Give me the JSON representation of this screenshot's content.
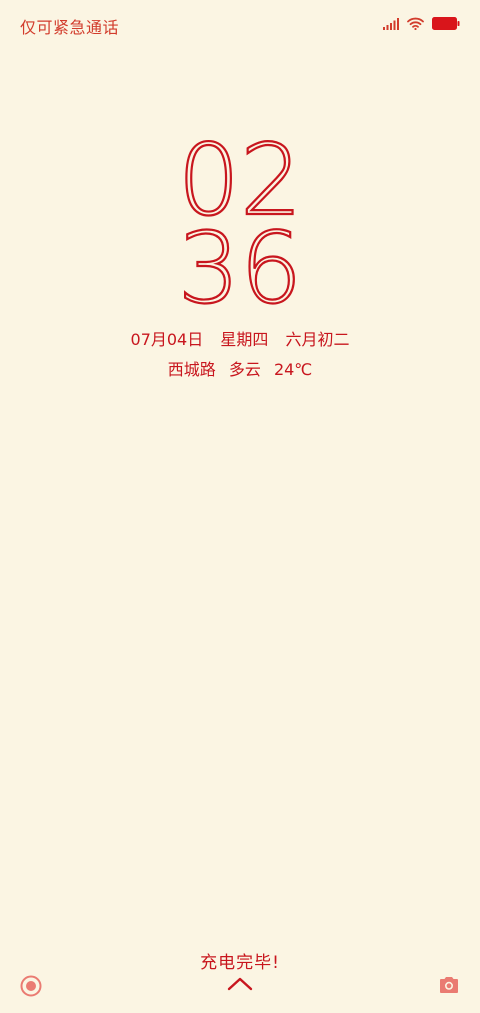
{
  "status_bar": {
    "carrier_text": "仅可紧急通话",
    "icons": [
      "signal-icon",
      "wifi-icon",
      "battery-icon"
    ]
  },
  "clock": {
    "hour": "02",
    "minute": "36"
  },
  "date": {
    "date": "07月04日",
    "weekday": "星期四",
    "lunar": "六月初二"
  },
  "weather": {
    "location": "西城路",
    "condition": "多云",
    "temperature": "24℃"
  },
  "charging": {
    "message": "充电完毕!"
  },
  "bottom": {
    "left_icon": "assistant-icon",
    "center_icon": "swipe-up-chevron-icon",
    "right_icon": "camera-icon"
  },
  "colors": {
    "background": "#fbf5e3",
    "accent": "#c8161e",
    "accent_light": "#ea7b72"
  }
}
